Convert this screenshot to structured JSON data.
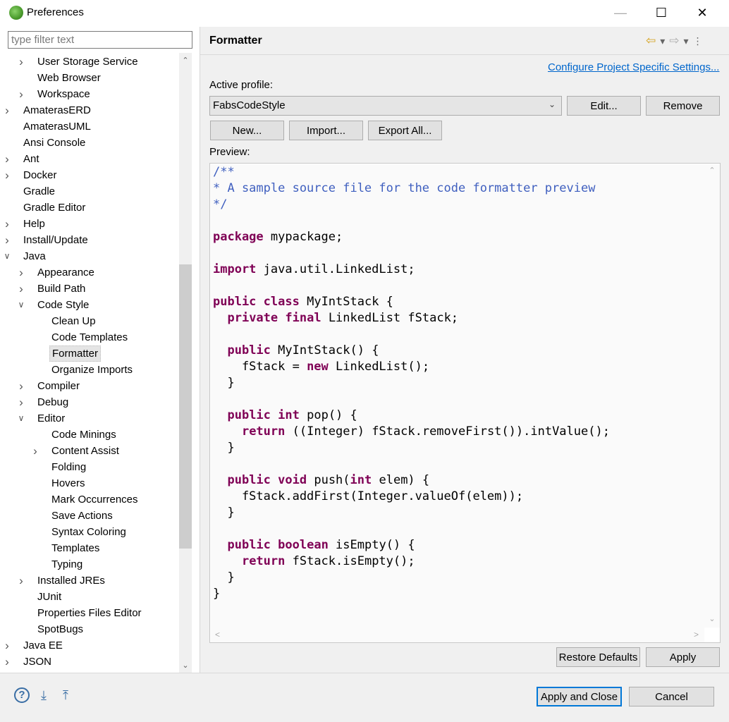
{
  "window": {
    "title": "Preferences"
  },
  "filter": {
    "placeholder": "type filter text"
  },
  "tree": [
    {
      "label": "User Storage Service",
      "level": 1,
      "chevron": ">"
    },
    {
      "label": "Web Browser",
      "level": 1,
      "chevron": ""
    },
    {
      "label": "Workspace",
      "level": 1,
      "chevron": ">"
    },
    {
      "label": "AmaterasERD",
      "level": 0,
      "chevron": ">"
    },
    {
      "label": "AmaterasUML",
      "level": 0,
      "chevron": ""
    },
    {
      "label": "Ansi Console",
      "level": 0,
      "chevron": ""
    },
    {
      "label": "Ant",
      "level": 0,
      "chevron": ">"
    },
    {
      "label": "Docker",
      "level": 0,
      "chevron": ">"
    },
    {
      "label": "Gradle",
      "level": 0,
      "chevron": ""
    },
    {
      "label": "Gradle Editor",
      "level": 0,
      "chevron": ""
    },
    {
      "label": "Help",
      "level": 0,
      "chevron": ">"
    },
    {
      "label": "Install/Update",
      "level": 0,
      "chevron": ">"
    },
    {
      "label": "Java",
      "level": 0,
      "chevron": "v"
    },
    {
      "label": "Appearance",
      "level": 1,
      "chevron": ">"
    },
    {
      "label": "Build Path",
      "level": 1,
      "chevron": ">"
    },
    {
      "label": "Code Style",
      "level": 1,
      "chevron": "v"
    },
    {
      "label": "Clean Up",
      "level": 2,
      "chevron": ""
    },
    {
      "label": "Code Templates",
      "level": 2,
      "chevron": ""
    },
    {
      "label": "Formatter",
      "level": 2,
      "chevron": "",
      "selected": true
    },
    {
      "label": "Organize Imports",
      "level": 2,
      "chevron": ""
    },
    {
      "label": "Compiler",
      "level": 1,
      "chevron": ">"
    },
    {
      "label": "Debug",
      "level": 1,
      "chevron": ">"
    },
    {
      "label": "Editor",
      "level": 1,
      "chevron": "v"
    },
    {
      "label": "Code Minings",
      "level": 2,
      "chevron": ""
    },
    {
      "label": "Content Assist",
      "level": 2,
      "chevron": ">"
    },
    {
      "label": "Folding",
      "level": 2,
      "chevron": ""
    },
    {
      "label": "Hovers",
      "level": 2,
      "chevron": ""
    },
    {
      "label": "Mark Occurrences",
      "level": 2,
      "chevron": ""
    },
    {
      "label": "Save Actions",
      "level": 2,
      "chevron": ""
    },
    {
      "label": "Syntax Coloring",
      "level": 2,
      "chevron": ""
    },
    {
      "label": "Templates",
      "level": 2,
      "chevron": ""
    },
    {
      "label": "Typing",
      "level": 2,
      "chevron": ""
    },
    {
      "label": "Installed JREs",
      "level": 1,
      "chevron": ">"
    },
    {
      "label": "JUnit",
      "level": 1,
      "chevron": ""
    },
    {
      "label": "Properties Files Editor",
      "level": 1,
      "chevron": ""
    },
    {
      "label": "SpotBugs",
      "level": 1,
      "chevron": ""
    },
    {
      "label": "Java EE",
      "level": 0,
      "chevron": ">"
    },
    {
      "label": "JSON",
      "level": 0,
      "chevron": ">"
    }
  ],
  "page": {
    "title": "Formatter",
    "configure_link": "Configure Project Specific Settings...",
    "active_profile_label": "Active profile:",
    "profile_value": "FabsCodeStyle",
    "edit_label": "Edit...",
    "remove_label": "Remove",
    "new_label": "New...",
    "import_label": "Import...",
    "export_label": "Export All...",
    "preview_label": "Preview:",
    "restore_label": "Restore Defaults",
    "apply_label": "Apply"
  },
  "preview_code": [
    [
      [
        "cm",
        "/**"
      ]
    ],
    [
      [
        "cm",
        "* A sample source file for the code formatter preview"
      ]
    ],
    [
      [
        "cm",
        "*/"
      ]
    ],
    [],
    [
      [
        "kw",
        "package"
      ],
      [
        "",
        " mypackage;"
      ]
    ],
    [],
    [
      [
        "kw",
        "import"
      ],
      [
        "",
        " java.util.LinkedList;"
      ]
    ],
    [],
    [
      [
        "kw",
        "public"
      ],
      [
        "",
        " "
      ],
      [
        "kw",
        "class"
      ],
      [
        "",
        " MyIntStack {"
      ]
    ],
    [
      [
        "",
        "  "
      ],
      [
        "kw",
        "private"
      ],
      [
        "",
        " "
      ],
      [
        "kw",
        "final"
      ],
      [
        "",
        " LinkedList fStack;"
      ]
    ],
    [],
    [
      [
        "",
        "  "
      ],
      [
        "kw",
        "public"
      ],
      [
        "",
        " MyIntStack() {"
      ]
    ],
    [
      [
        "",
        "    fStack = "
      ],
      [
        "kw",
        "new"
      ],
      [
        "",
        " LinkedList();"
      ]
    ],
    [
      [
        "",
        "  }"
      ]
    ],
    [],
    [
      [
        "",
        "  "
      ],
      [
        "kw",
        "public"
      ],
      [
        "",
        " "
      ],
      [
        "kw",
        "int"
      ],
      [
        "",
        " pop() {"
      ]
    ],
    [
      [
        "",
        "    "
      ],
      [
        "kw",
        "return"
      ],
      [
        "",
        " ((Integer) fStack.removeFirst()).intValue();"
      ]
    ],
    [
      [
        "",
        "  }"
      ]
    ],
    [],
    [
      [
        "",
        "  "
      ],
      [
        "kw",
        "public"
      ],
      [
        "",
        " "
      ],
      [
        "kw",
        "void"
      ],
      [
        "",
        " push("
      ],
      [
        "kw",
        "int"
      ],
      [
        "",
        " elem) {"
      ]
    ],
    [
      [
        "",
        "    fStack.addFirst(Integer.valueOf(elem));"
      ]
    ],
    [
      [
        "",
        "  }"
      ]
    ],
    [],
    [
      [
        "",
        "  "
      ],
      [
        "kw",
        "public"
      ],
      [
        "",
        " "
      ],
      [
        "kw",
        "boolean"
      ],
      [
        "",
        " isEmpty() {"
      ]
    ],
    [
      [
        "",
        "    "
      ],
      [
        "kw",
        "return"
      ],
      [
        "",
        " fStack.isEmpty();"
      ]
    ],
    [
      [
        "",
        "  }"
      ]
    ],
    [
      [
        "",
        "}"
      ]
    ]
  ],
  "footer": {
    "apply_close_label": "Apply and Close",
    "cancel_label": "Cancel",
    "icons": [
      "help-icon",
      "import-icon",
      "export-icon"
    ]
  }
}
